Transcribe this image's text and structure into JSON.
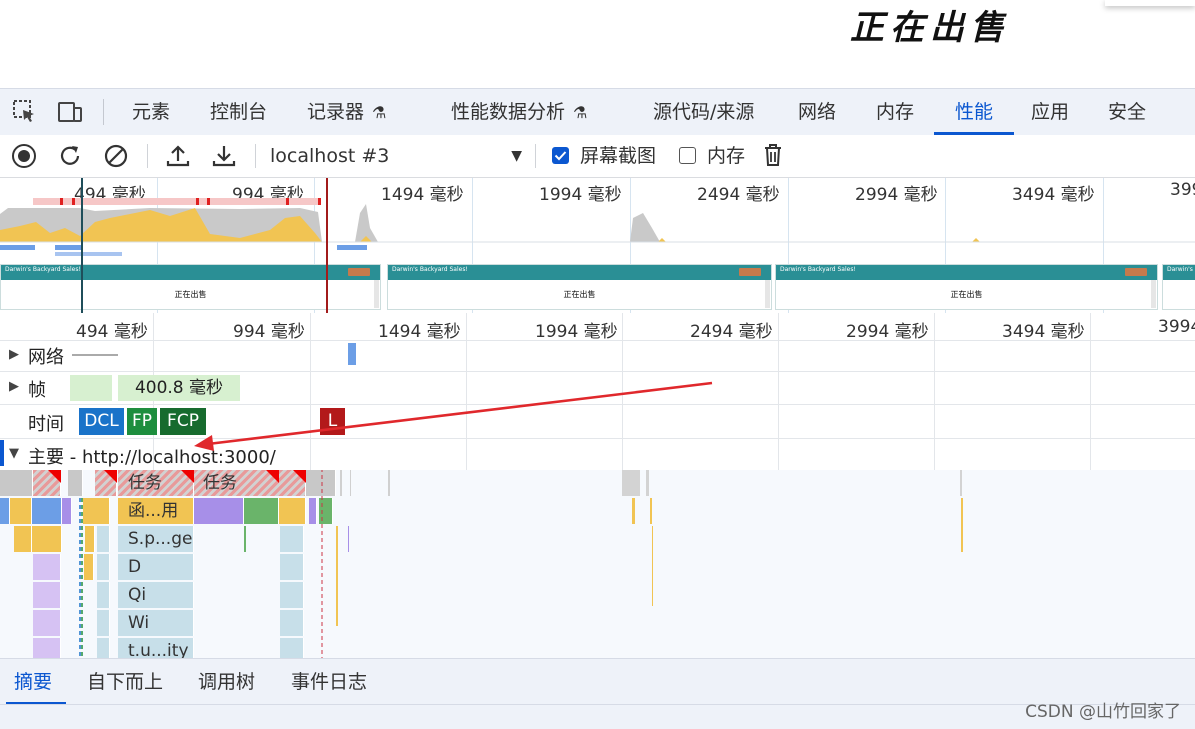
{
  "page": {
    "heading": "正在出售"
  },
  "devtools_tabs": [
    {
      "label": "元素"
    },
    {
      "label": "控制台"
    },
    {
      "label": "记录器"
    },
    {
      "label": "性能数据分析"
    },
    {
      "label": "源代码/来源"
    },
    {
      "label": "网络"
    },
    {
      "label": "内存"
    },
    {
      "label": "性能",
      "active": true
    },
    {
      "label": "应用"
    },
    {
      "label": "安全"
    }
  ],
  "perf_toolbar": {
    "recording": "localhost #3",
    "screenshots_label": "屏幕截图",
    "screenshots_checked": true,
    "memory_label": "内存",
    "memory_checked": false
  },
  "overview": {
    "ticks": [
      "494 毫秒",
      "994 毫秒",
      "1494 毫秒",
      "1994 毫秒",
      "2494 毫秒",
      "2994 毫秒",
      "3494 毫秒",
      "399"
    ],
    "screenshot_title": "Darwin's Backyard Sales!",
    "screenshot_button": "Logout",
    "screenshot_text": "正在出售"
  },
  "timeline": {
    "ticks": [
      "494 毫秒",
      "994 毫秒",
      "1494 毫秒",
      "1994 毫秒",
      "2494 毫秒",
      "2994 毫秒",
      "3494 毫秒",
      "3994"
    ],
    "network_label": "网络",
    "frames_label": "帧",
    "frame_duration": "400.8 毫秒",
    "timings_label": "时间",
    "markers": {
      "dcl": "DCL",
      "fp": "FP",
      "fcp": "FCP",
      "l": "L"
    },
    "main_label": "主要",
    "main_url": "- http://localhost:3000/",
    "flame_labels": [
      "任务",
      "任务",
      "函...用",
      "S.p...ge",
      "D",
      "Qi",
      "Wi",
      "t.u...ity"
    ]
  },
  "bottom_tabs": [
    {
      "label": "摘要",
      "active": true
    },
    {
      "label": "自下而上"
    },
    {
      "label": "调用树"
    },
    {
      "label": "事件日志"
    }
  ],
  "watermark": "CSDN @山竹回家了",
  "colors": {
    "accent": "#0b57d0",
    "task_red": "#e05a5a",
    "scripting_yellow": "#f1c453",
    "rendering_purple": "#a78fe8",
    "painting_green": "#6ab46a",
    "loading_blue": "#6c9ee6",
    "idle_blue": "#c7dfe9",
    "arrow_red": "#e0282c"
  }
}
